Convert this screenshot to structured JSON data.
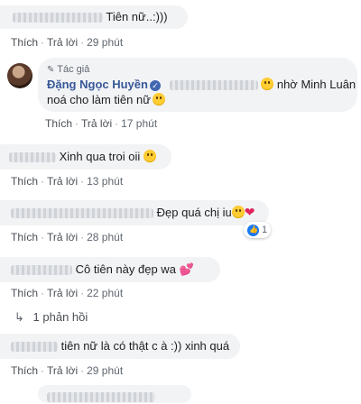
{
  "actions": {
    "like": "Thích",
    "reply": "Trả lời",
    "dot": "·"
  },
  "comments": [
    {
      "text": "Tiên nữ..:)))",
      "time": "29 phút"
    },
    {
      "author_badge": "Tác giả",
      "author": "Đặng Ngọc Huyền",
      "text_a": "nhờ Minh Luân",
      "text_b": "noá cho làm tiên nữ",
      "time": "17 phút"
    },
    {
      "text": "Xinh qua troi oii",
      "time": "13 phút"
    },
    {
      "text": "Đẹp quá chị iu",
      "time": "28 phút",
      "reaction_count": "1"
    },
    {
      "text": "Cô tiên này đẹp wa",
      "time": "22 phút",
      "replies": "1 phản hồi"
    },
    {
      "text": "tiên nữ là có thật c à :)) xinh quá",
      "time": "29 phút"
    }
  ],
  "icons": {
    "pencil": "pencil-icon",
    "verified": "verified-badge-icon",
    "reply_arrow": "reply-arrow-icon",
    "like_reaction": "like-reaction-icon"
  },
  "colors": {
    "author": "#385898",
    "bubble": "#f2f3f5",
    "meta": "#606770",
    "like_blue": "#1877f2",
    "heart": "#e0245e"
  }
}
